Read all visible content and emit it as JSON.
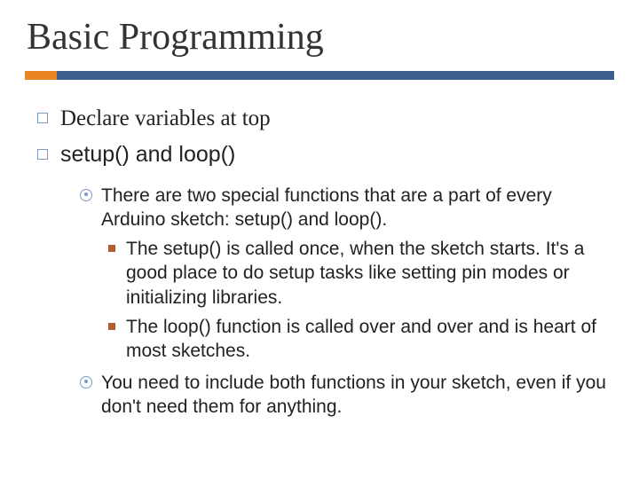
{
  "title": "Basic Programming",
  "colors": {
    "accent": "#e98621",
    "bar": "#3b5e8c",
    "bullet_box": "#7a9ac0",
    "bullet_square": "#b85c2e"
  },
  "items": [
    {
      "text": "Declare variables at top",
      "style": "serif"
    },
    {
      "text": "setup() and loop()",
      "style": "sans",
      "children": [
        {
          "text": "There are two special functions that are a part of every Arduino sketch: setup() and loop().",
          "children": [
            {
              "text": "The setup() is called once, when the sketch starts. It's a good place to do setup tasks like setting pin modes or initializing libraries."
            },
            {
              "text": "The loop() function is called over and over and is heart of most sketches."
            }
          ]
        },
        {
          "text": "You need to include both functions in your sketch, even if you don't need them for anything."
        }
      ]
    }
  ]
}
